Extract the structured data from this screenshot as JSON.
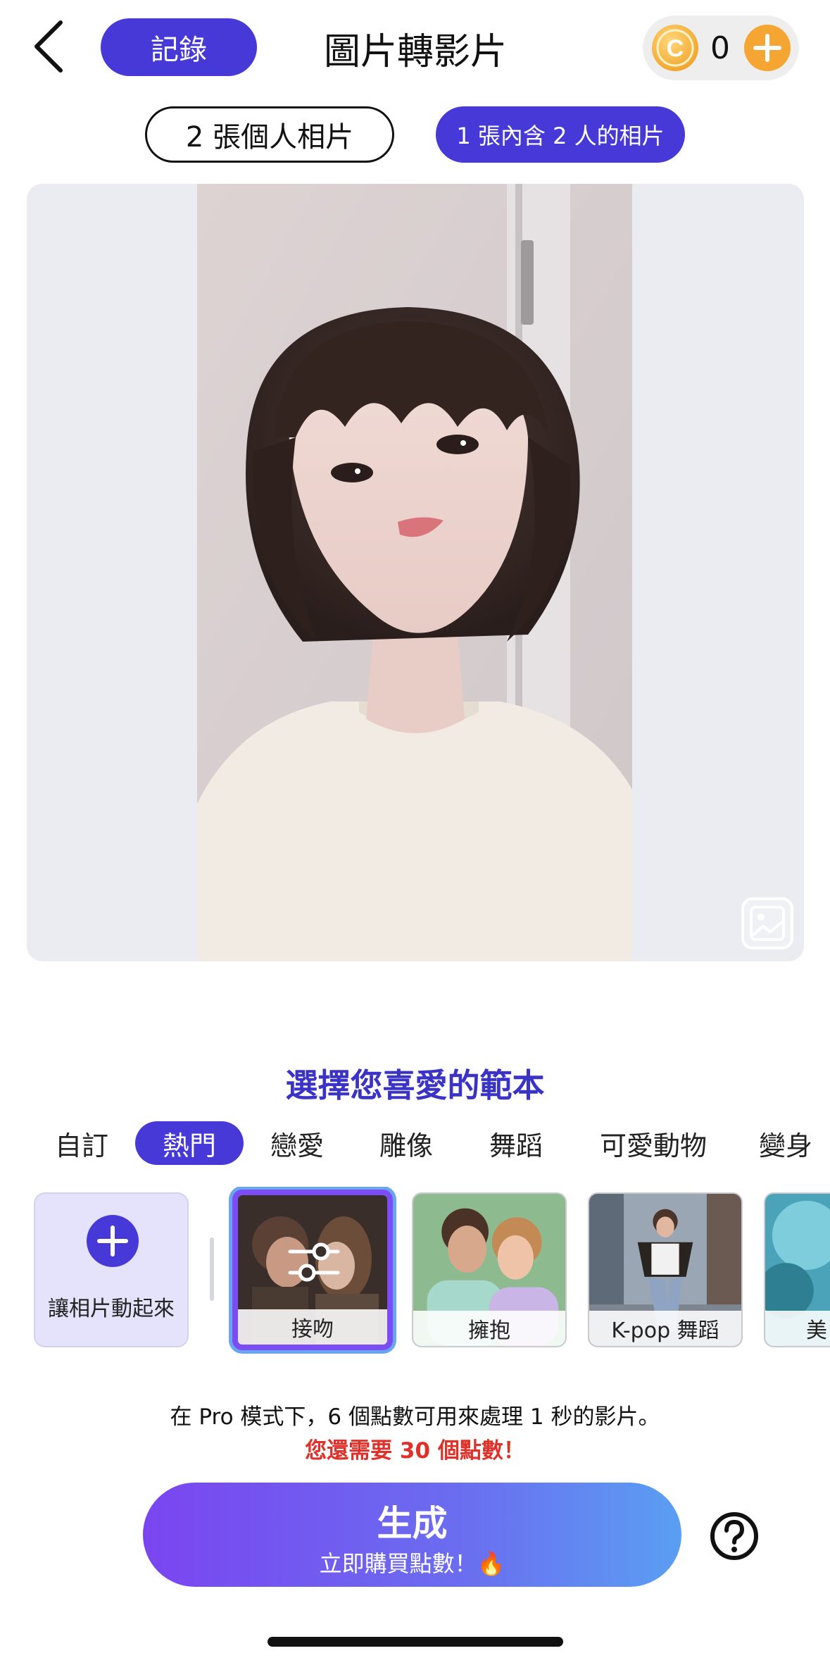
{
  "header": {
    "records_label": "記錄",
    "title": "圖片轉影片",
    "coin_symbol": "C",
    "coin_count": "0"
  },
  "modes": {
    "two_photos": "2 張個人相片",
    "one_photo": "1 張內含 2 人的相片",
    "selected": "one_photo"
  },
  "preview": {
    "image": "portrait-photo"
  },
  "templates": {
    "section_title": "選擇您喜愛的範本",
    "categories": [
      "自訂",
      "熱門",
      "戀愛",
      "雕像",
      "舞蹈",
      "可愛動物",
      "變身"
    ],
    "active_category": "熱門",
    "animate_label": "讓相片動起來",
    "items": [
      "接吻",
      "擁抱",
      "K-pop 舞蹈",
      "美"
    ],
    "selected_item": "接吻"
  },
  "footer": {
    "info_line": "在 Pro 模式下，6 個點數可用來處理 1 秒的影片。",
    "points_needed": "您還需要 30 個點數！",
    "generate_label": "生成",
    "buy_label": "立即購買點數！🔥"
  },
  "colors": {
    "accent": "#4639d8",
    "alert": "#e0302a",
    "coin": "#f5a531"
  }
}
